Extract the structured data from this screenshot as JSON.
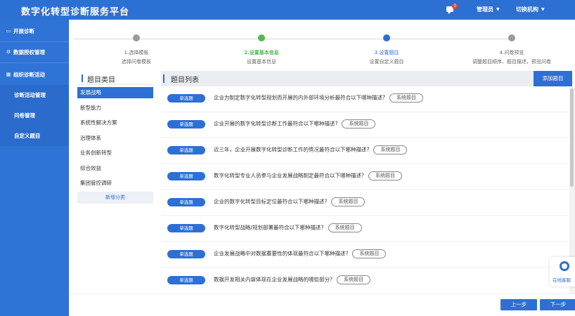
{
  "header": {
    "title": "数字化转型诊断服务平台",
    "message_badge": "3",
    "user_menu": "管理员",
    "switch_org": "切换机构"
  },
  "sidebar": {
    "items": [
      {
        "label": "开展诊断",
        "icon": "monitor-icon"
      },
      {
        "label": "数据授权管理",
        "icon": "gear-icon"
      },
      {
        "label": "组织诊断活动",
        "icon": "grid-icon"
      },
      {
        "label": "诊断活动管理"
      },
      {
        "label": "问卷管理"
      },
      {
        "label": "自定义题目"
      }
    ]
  },
  "steps": [
    {
      "title": "1.选择模板",
      "desc": "选择问卷模板",
      "color": "#9a9a9a"
    },
    {
      "title": "2.设置基本信息",
      "desc": "设置基本信息",
      "color": "#55b955"
    },
    {
      "title": "3.设置题目",
      "desc": "设置自定义题目",
      "color": "#2b6fd4"
    },
    {
      "title": "4.问卷预览",
      "desc": "调整题目顺序、题目描述，预览问卷",
      "color": "#9a9a9a"
    }
  ],
  "categories": {
    "title": "题目类目",
    "items": [
      "发展战略",
      "新型能力",
      "系统性解决方案",
      "治理体系",
      "业务创新转型",
      "综合效益",
      "集团管控调研"
    ],
    "add_label": "新增分类"
  },
  "questions": {
    "title": "题目列表",
    "add_label": "添加题目",
    "rows": [
      {
        "type": "单选题",
        "text": "企业为制定数字化转型规划而开展的内外部环境分析最符合以下哪种描述?",
        "tag": "系统题目"
      },
      {
        "type": "单选题",
        "text": "企业开展的数字化转型诊断工作最符合以下哪种描述?",
        "tag": "系统题目"
      },
      {
        "type": "单选题",
        "text": "近三年，企业开展数字化转型诊断工作的情况最符合以下哪种描述?",
        "tag": "系统题目"
      },
      {
        "type": "单选题",
        "text": "数字化转型专业人员参与企业发展战略制定最符合以下哪种描述?",
        "tag": "系统题目"
      },
      {
        "type": "单选题",
        "text": "企业的数字化转型目标定位最符合以下哪种描述?",
        "tag": "系统题目"
      },
      {
        "type": "单选题",
        "text": "数字化转型战略/规划部署最符合以下哪种描述?",
        "tag": "系统题目"
      },
      {
        "type": "单选题",
        "text": "企业发展战略中对数据重要性的体现最符合以下哪种描述?",
        "tag": "系统题目"
      },
      {
        "type": "单选题",
        "text": "数据开发相关内容体现在企业发展战略的哪些部分?",
        "tag": "系统题目"
      }
    ]
  },
  "footer": {
    "prev_label": "上一步",
    "next_label": "下一步"
  },
  "service": {
    "label": "在线客服"
  },
  "colors": {
    "primary": "#2d6fd4",
    "header_bg": "#2d70d3",
    "sidebar_bg": "#2f73d6",
    "done_green": "#55b955"
  }
}
